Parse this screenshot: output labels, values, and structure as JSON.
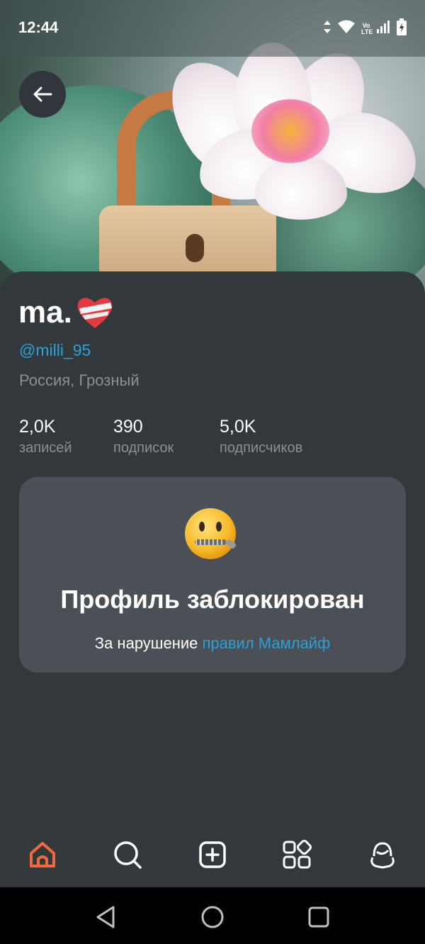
{
  "status_bar": {
    "time": "12:44",
    "icons": [
      "data-arrows-icon",
      "wifi-icon",
      "volte-icon",
      "signal-icon",
      "battery-icon"
    ],
    "volte_label": "Vo LTE"
  },
  "profile": {
    "name": "ma.",
    "handle": "@milli_95",
    "location": "Россия, Грозный",
    "stats": [
      {
        "value": "2,0K",
        "label": "записей"
      },
      {
        "value": "390",
        "label": "подписок"
      },
      {
        "value": "5,0K",
        "label": "подписчиков"
      }
    ]
  },
  "blocked": {
    "title": "Профиль заблокирован",
    "reason_prefix": "За нарушение ",
    "reason_link": "правил Мамлайф"
  },
  "colors": {
    "accent": "#2aa1d6",
    "home_active": "#f26a3b",
    "background": "#33383d",
    "card": "#4a5056"
  },
  "bottom_nav": [
    "home-icon",
    "search-icon",
    "add-post-icon",
    "services-icon",
    "support-icon"
  ],
  "system_nav": [
    "back-triangle-icon",
    "home-circle-icon",
    "recents-square-icon"
  ]
}
